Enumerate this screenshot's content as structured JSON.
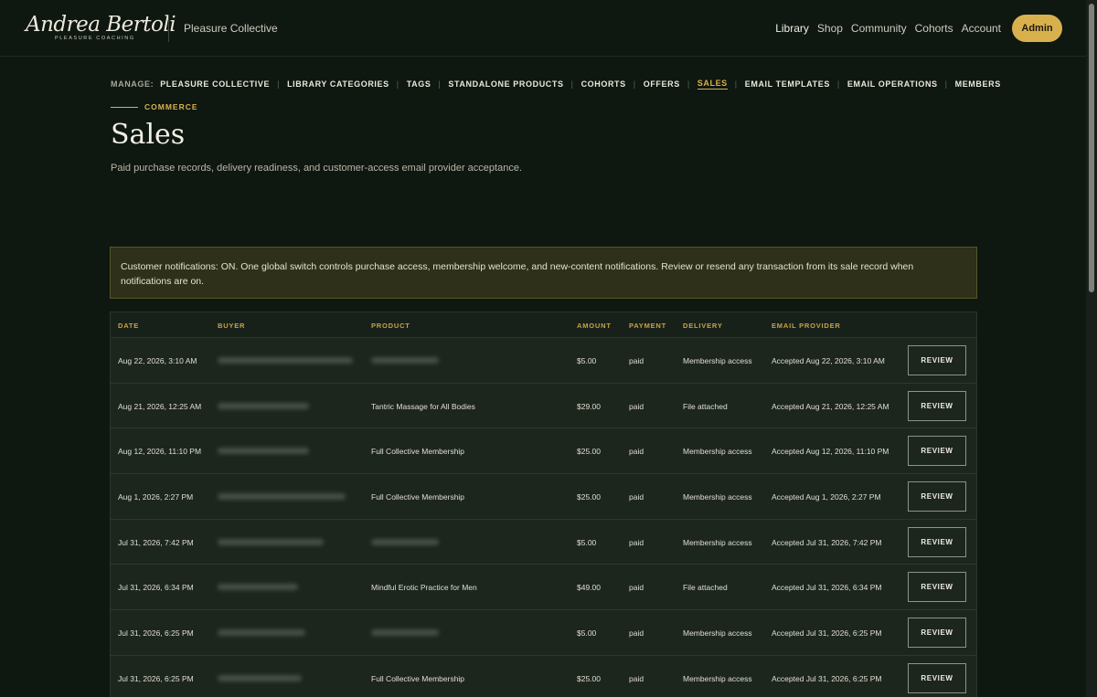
{
  "header": {
    "logo_script": "Andrea Bertoli",
    "logo_subtitle": "PLEASURE COACHING",
    "brand": "Pleasure Collective",
    "nav": [
      "Library",
      "Shop",
      "Community",
      "Cohorts",
      "Account"
    ],
    "active_nav": "Library",
    "admin_label": "Admin"
  },
  "manage": {
    "label": "MANAGE:",
    "items": [
      "PLEASURE COLLECTIVE",
      "LIBRARY CATEGORIES",
      "TAGS",
      "STANDALONE PRODUCTS",
      "COHORTS",
      "OFFERS",
      "SALES",
      "EMAIL TEMPLATES",
      "EMAIL OPERATIONS",
      "MEMBERS"
    ],
    "active": "SALES"
  },
  "section": {
    "eyebrow": "COMMERCE",
    "title": "Sales",
    "description": "Paid purchase records, delivery readiness, and customer-access email provider acceptance."
  },
  "notice": {
    "text": "Customer notifications: ON. One global switch controls purchase access, membership welcome, and new-content notifications. Review or resend any transaction from its sale record when notifications are on."
  },
  "table": {
    "columns": {
      "date": "DATE",
      "buyer": "BUYER",
      "product": "PRODUCT",
      "amount": "AMOUNT",
      "payment": "PAYMENT",
      "delivery": "DELIVERY",
      "email_provider": "EMAIL PROVIDER"
    },
    "review_label": "REVIEW",
    "rows": [
      {
        "date": "Aug 22, 2026, 3:10 AM",
        "product": "",
        "amount": "$5.00",
        "payment": "paid",
        "delivery": "Membership access",
        "email_provider": "Accepted Aug 22, 2026, 3:10 AM"
      },
      {
        "date": "Aug 21, 2026, 12:25 AM",
        "product": "Tantric Massage for All Bodies",
        "amount": "$29.00",
        "payment": "paid",
        "delivery": "File attached",
        "email_provider": "Accepted Aug 21, 2026, 12:25 AM"
      },
      {
        "date": "Aug 12, 2026, 11:10 PM",
        "product": "Full Collective Membership",
        "amount": "$25.00",
        "payment": "paid",
        "delivery": "Membership access",
        "email_provider": "Accepted Aug 12, 2026, 11:10 PM"
      },
      {
        "date": "Aug 1, 2026, 2:27 PM",
        "product": "Full Collective Membership",
        "amount": "$25.00",
        "payment": "paid",
        "delivery": "Membership access",
        "email_provider": "Accepted Aug 1, 2026, 2:27 PM"
      },
      {
        "date": "Jul 31, 2026, 7:42 PM",
        "product": "",
        "amount": "$5.00",
        "payment": "paid",
        "delivery": "Membership access",
        "email_provider": "Accepted Jul 31, 2026, 7:42 PM"
      },
      {
        "date": "Jul 31, 2026, 6:34 PM",
        "product": "Mindful Erotic Practice for Men",
        "amount": "$49.00",
        "payment": "paid",
        "delivery": "File attached",
        "email_provider": "Accepted Jul 31, 2026, 6:34 PM"
      },
      {
        "date": "Jul 31, 2026, 6:25 PM",
        "product": "",
        "amount": "$5.00",
        "payment": "paid",
        "delivery": "Membership access",
        "email_provider": "Accepted Jul 31, 2026, 6:25 PM"
      },
      {
        "date": "Jul 31, 2026, 6:25 PM",
        "product": "Full Collective Membership",
        "amount": "$25.00",
        "payment": "paid",
        "delivery": "Membership access",
        "email_provider": "Accepted Jul 31, 2026, 6:25 PM"
      }
    ]
  }
}
